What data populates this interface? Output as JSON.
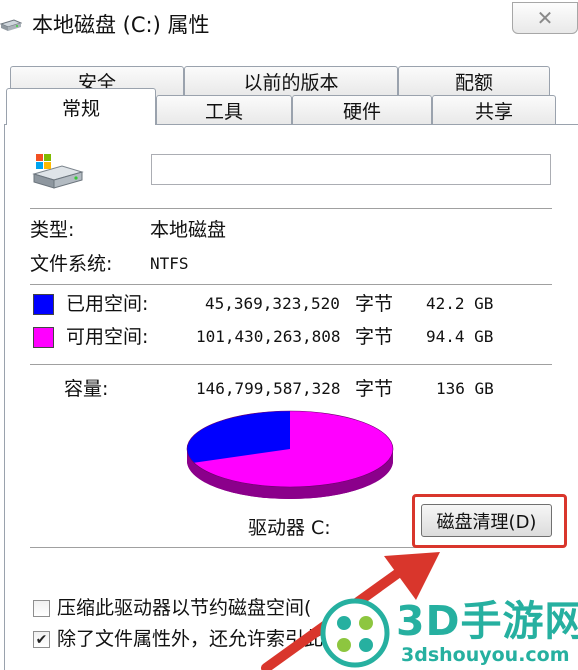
{
  "window": {
    "title": "本地磁盘 (C:) 属性",
    "close_glyph": "✕",
    "icon": "drive-properties-icon"
  },
  "tabs": {
    "row_back": [
      {
        "label": "安全"
      },
      {
        "label": "以前的版本"
      },
      {
        "label": "配额"
      }
    ],
    "row_front": [
      {
        "label": "常规",
        "active": true
      },
      {
        "label": "工具"
      },
      {
        "label": "硬件"
      },
      {
        "label": "共享"
      }
    ]
  },
  "general": {
    "drive_icon": "hard-drive-icon",
    "volume_label_value": "",
    "type_label": "类型:",
    "type_value": "本地磁盘",
    "fs_label": "文件系统:",
    "fs_value": "NTFS",
    "used": {
      "label": "已用空间:",
      "bytes": "45,369,323,520",
      "unit": "字节",
      "size": "42.2 GB",
      "color": "#0000ff"
    },
    "free": {
      "label": "可用空间:",
      "bytes": "101,430,263,808",
      "unit": "字节",
      "size": "94.4 GB",
      "color": "#ff00ff"
    },
    "capacity": {
      "label": "容量:",
      "bytes": "146,799,587,328",
      "unit": "字节",
      "size": "136 GB"
    },
    "used_fraction": 0.309,
    "drive_label": "驱动器 C:",
    "cleanup_button": "磁盘清理(D)",
    "compress_label": "压缩此驱动器以节约磁盘空间(",
    "compress_checked": false,
    "index_label": "除了文件属性外，还允许索引此",
    "index_checked": true,
    "highlight_color": "#d9362c"
  },
  "watermark": {
    "brand": "3D手游网",
    "domain": "3dshouyou.com",
    "color": "#26b0a0"
  }
}
